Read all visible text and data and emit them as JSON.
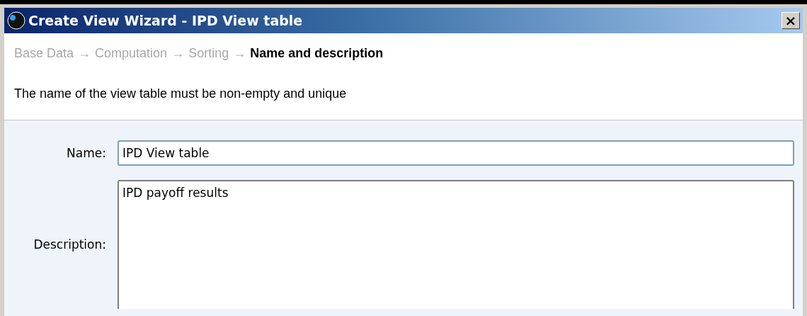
{
  "window": {
    "title": "Create View Wizard - IPD View table",
    "close": "×"
  },
  "steps": [
    {
      "label": "Base Data",
      "selected": false
    },
    {
      "label": "Computation",
      "selected": false
    },
    {
      "label": "Sorting",
      "selected": false
    },
    {
      "label": "Name and description",
      "selected": true
    }
  ],
  "step_arrows": [
    "→",
    "→",
    "→"
  ],
  "message": "The name of the view table must be non-empty and unique",
  "form": {
    "name": {
      "label": "Name:",
      "value": "IPD View table",
      "focused": true
    },
    "description": {
      "label": "Description:",
      "value": "IPD payoff results"
    }
  }
}
